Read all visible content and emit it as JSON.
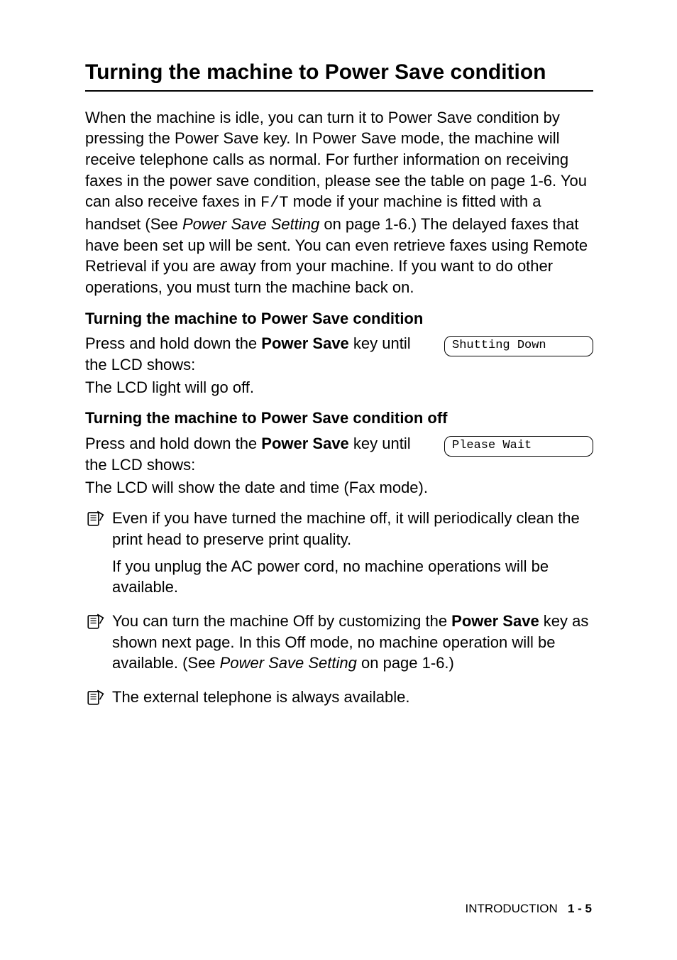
{
  "heading": "Turning the machine to Power Save condition",
  "intro": {
    "part1": "When the machine is idle, you can turn it to Power Save condition by pressing the Power Save key. In Power Save mode, the machine will receive telephone calls as normal. For further information on receiving faxes in the power save condition, please see the table on page 1-6. You can also receive faxes in ",
    "code": "F/T",
    "part2": " mode if your machine is fitted with a handset (See ",
    "ref": "Power Save Setting",
    "part3": " on page 1-6.) The delayed faxes that have been set up will be sent. You can even retrieve faxes using Remote Retrieval if you are away from your machine. If you want to do other operations, you must turn the machine back on."
  },
  "section_on": {
    "title": "Turning the machine to Power Save condition",
    "instr_pre": "Press and hold down the ",
    "instr_key": "Power Save",
    "instr_post": " key until the LCD shows:",
    "lcd": "Shutting Down",
    "after": "The LCD light will go off."
  },
  "section_off": {
    "title": "Turning the machine to Power Save condition off",
    "instr_pre": "Press and hold down the ",
    "instr_key": "Power Save",
    "instr_post": " key until the LCD shows:",
    "lcd": "Please Wait",
    "after": "The LCD will show the date and time (Fax mode)."
  },
  "note1": {
    "p1": "Even if you have turned the machine off, it will periodically clean the print head to preserve print quality.",
    "p2": "If you unplug the AC power cord, no machine operations will be available."
  },
  "note2": {
    "pre": "You can turn the machine Off by customizing the ",
    "key": "Power Save",
    "mid": " key as shown next page. In this Off mode, no machine operation will be available. (See ",
    "ref": "Power Save Setting",
    "post": " on page 1-6.)"
  },
  "note3": "The external telephone is always available.",
  "footer": {
    "section": "INTRODUCTION",
    "page": "1 - 5"
  }
}
